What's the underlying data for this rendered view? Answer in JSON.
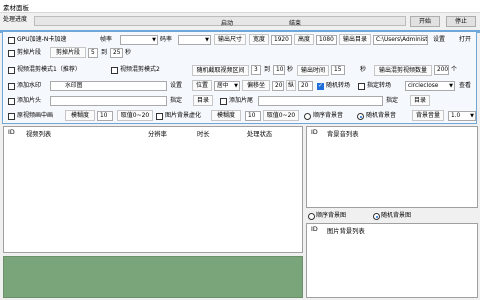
{
  "window": {
    "title": "素材面板"
  },
  "top": {
    "status_label": "处理进度",
    "progress_left": "启动",
    "progress_right": "结束",
    "start_button": "开始",
    "stop_button": "停止"
  },
  "row1": {
    "gpu_label": "GPU加速-N卡加速",
    "framerate_label": "帧率",
    "framerate_value": "",
    "bitrate_label": "码率",
    "bitrate_value": "",
    "out_size_button": "输出尺寸",
    "width_label": "宽度",
    "width_value": "1920",
    "height_label": "高度",
    "height_value": "1080",
    "out_dir_button": "输出目录",
    "out_dir_value": "C:\\Users\\Administrat",
    "settings_button": "设置",
    "open_button": "打开"
  },
  "row2": {
    "trim_label": "剪掉片段",
    "trim_title": "剪掉片段",
    "trim_from": "5",
    "trim_to_label": "到",
    "trim_to": "25",
    "trim_unit": "秒"
  },
  "row3": {
    "mode1_label": "视频混剪模式1（推荐）",
    "mode2_label": "视频混剪模式2",
    "random_range_button": "随机截取视频区间",
    "range_from": "3",
    "range_to_label": "到",
    "range_to": "10",
    "range_unit": "秒",
    "out_time_button": "输出时间",
    "out_time_value": "15",
    "out_time_unit": "秒",
    "out_count_button": "输出混剪视频数量",
    "out_count_value": "200",
    "out_count_unit": "个"
  },
  "row4": {
    "watermark_label": "添加水印",
    "watermark_button": "水印图",
    "settings_button": "设置",
    "position_button": "位置",
    "position_value": "居中",
    "x_offset_label": "偏移坐",
    "x_offset_value": "20",
    "y_offset_label": "纵",
    "y_offset_value": "20",
    "random_transition_label": "随机转场",
    "fixed_transition_label": "指定转场",
    "transition_value": "circleclose",
    "preview_button": "查看"
  },
  "row5": {
    "intro_label": "添加片头",
    "intro_assign": "指定",
    "intro_dir": "目录",
    "outro_label": "添加片尾",
    "outro_assign": "指定",
    "outro_dir": "目录"
  },
  "row6": {
    "bgblur_label": "原视频画中画",
    "blur_button": "模糊度",
    "blur_value": "10",
    "blur_range": "取值0~20",
    "bgimg_blur_label": "图片背景虚化",
    "blur2_button": "模糊度",
    "blur2_value": "10",
    "blur2_range": "取值0~20",
    "seq_music_label": "顺序背景音",
    "random_music_label": "随机背景音",
    "volume_button": "背景音量",
    "volume_value": "1.0"
  },
  "video_table": {
    "columns": [
      "ID",
      "视频列表",
      "分辨率",
      "时长",
      "处理状态"
    ]
  },
  "music_table": {
    "columns": [
      "ID",
      "背景音列表"
    ]
  },
  "image_mode": {
    "seq_label": "顺序背景图",
    "random_label": "随机背景图"
  },
  "image_table": {
    "columns": [
      "ID",
      "图片背景列表"
    ]
  }
}
